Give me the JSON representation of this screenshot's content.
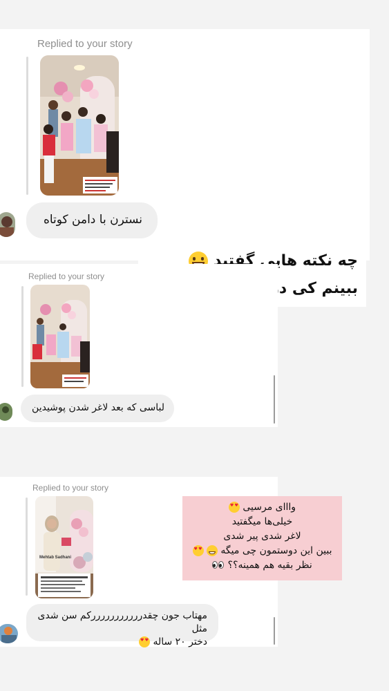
{
  "replies": [
    {
      "label": "Replied to your story",
      "message": "نسترن با دامن کوتاه"
    },
    {
      "label": "Replied to your story",
      "message": "لباسی  که بعد لاغر شدن پوشیدین"
    },
    {
      "label": "Replied to your story",
      "message_line1": "مهتاب جون چقدرررررررررررکم سن شدی مثل",
      "message_line2": "دختر ۲۰ ساله"
    }
  ],
  "captions": {
    "first": {
      "line1": "چه نکته هایی گفتید",
      "line2": "ببینم کی درست میگه؟"
    },
    "second": {
      "line1": "وااای مرسیی",
      "line2": "خیلی‌ها میگفتید",
      "line3": "لاغر شدی پیر شدی",
      "line4": "ببین این دوستمون چی میگه",
      "line5": "نظر بقیه هم همینه؟؟"
    }
  },
  "story_thumbnail_text": {
    "story3_name": "Mehtab Sadhani"
  },
  "icons": [
    "grin-emoji",
    "heart-eyes-emoji",
    "gift-emoji",
    "eyes-emoji"
  ],
  "colors": {
    "background": "#f3f3f3",
    "bubble": "#efefef",
    "caption_pink": "#f7ced2",
    "label_gray": "#8e8e8e"
  }
}
